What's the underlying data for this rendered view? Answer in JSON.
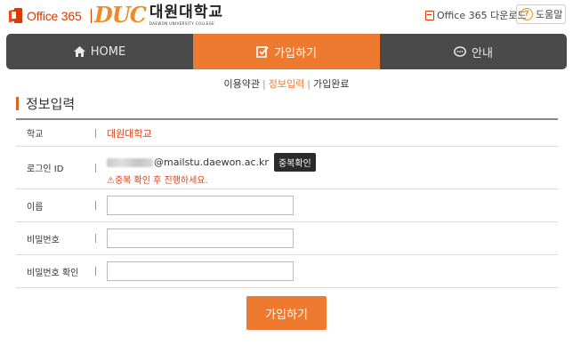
{
  "header": {
    "office_label": "Office 365",
    "duc_logo": "DUC",
    "duc_name": "대원대학교",
    "duc_sub": "DAEWON UNIVERSITY COLLEGE",
    "download_label": "Office 365 다운로드",
    "help_label": "도움말",
    "help_icon_glyph": "?"
  },
  "nav": {
    "tabs": [
      {
        "label": "HOME",
        "icon": "home-icon",
        "active": false
      },
      {
        "label": "가입하기",
        "icon": "edit-check-icon",
        "active": true
      },
      {
        "label": "안내",
        "icon": "chat-bubble-icon",
        "active": false
      }
    ]
  },
  "steps": {
    "items": [
      "이용약관",
      "정보입력",
      "가입완료"
    ],
    "separator": "|",
    "current_index": 1
  },
  "section_title": "정보입력",
  "form": {
    "school": {
      "label": "학교",
      "value": "대원대학교"
    },
    "login_id": {
      "label": "로그인 ID",
      "domain": "@mailstu.daewon.ac.kr",
      "check_button": "중복확인",
      "warning": "⚠중복 확인 후 진행하세요."
    },
    "name": {
      "label": "이름",
      "value": ""
    },
    "password": {
      "label": "비밀번호",
      "value": ""
    },
    "password_confirm": {
      "label": "비밀번호 확인",
      "value": ""
    }
  },
  "submit_label": "가입하기",
  "colors": {
    "accent": "#ee7a2f",
    "nav_bg": "#4a4a4a",
    "office_red": "#d83b01",
    "warning_red": "#d8421a"
  }
}
